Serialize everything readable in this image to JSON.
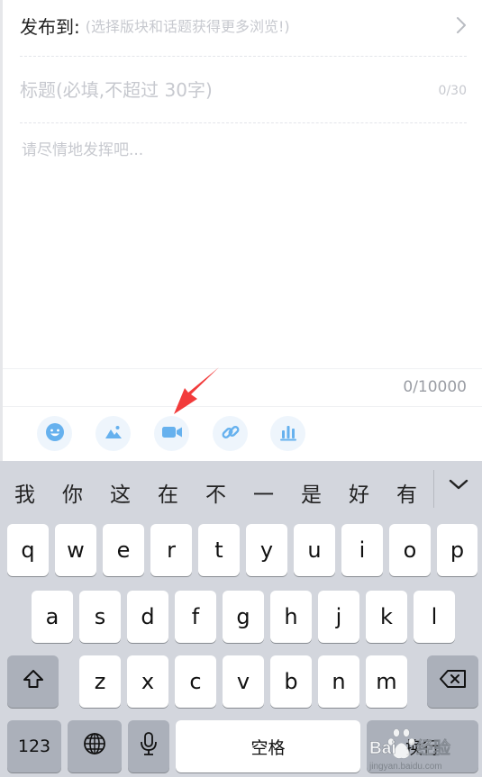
{
  "compose": {
    "publish_label": "发布到:",
    "publish_hint": "(选择版块和话题获得更多浏览!)",
    "title_placeholder": "标题(必填,不超过 30字)",
    "title_count": "0/30",
    "body_placeholder": "请尽情地发挥吧...",
    "body_count": "0/10000"
  },
  "toolbar": {
    "items": [
      {
        "icon": "emoji-icon"
      },
      {
        "icon": "image-icon"
      },
      {
        "icon": "video-icon"
      },
      {
        "icon": "link-icon"
      },
      {
        "icon": "poll-icon"
      }
    ],
    "accent": "#66b1ee",
    "bg": "#eef5fc"
  },
  "annotation": {
    "color": "#f23b3b"
  },
  "keyboard": {
    "candidates": [
      "我",
      "你",
      "这",
      "在",
      "不",
      "一",
      "是",
      "好",
      "有"
    ],
    "row1": [
      "q",
      "w",
      "e",
      "r",
      "t",
      "y",
      "u",
      "i",
      "o",
      "p"
    ],
    "row2": [
      "a",
      "s",
      "d",
      "f",
      "g",
      "h",
      "j",
      "k",
      "l"
    ],
    "row3": [
      "z",
      "x",
      "c",
      "v",
      "b",
      "n",
      "m"
    ],
    "numbers_label": "123",
    "space_label": "空格",
    "return_label": "换行",
    "bg": "#d3d6dd",
    "special_key_bg": "#abb0ba"
  },
  "watermark": {
    "brand": "Baidu 经验",
    "url": "jingyan.baidu.com"
  }
}
